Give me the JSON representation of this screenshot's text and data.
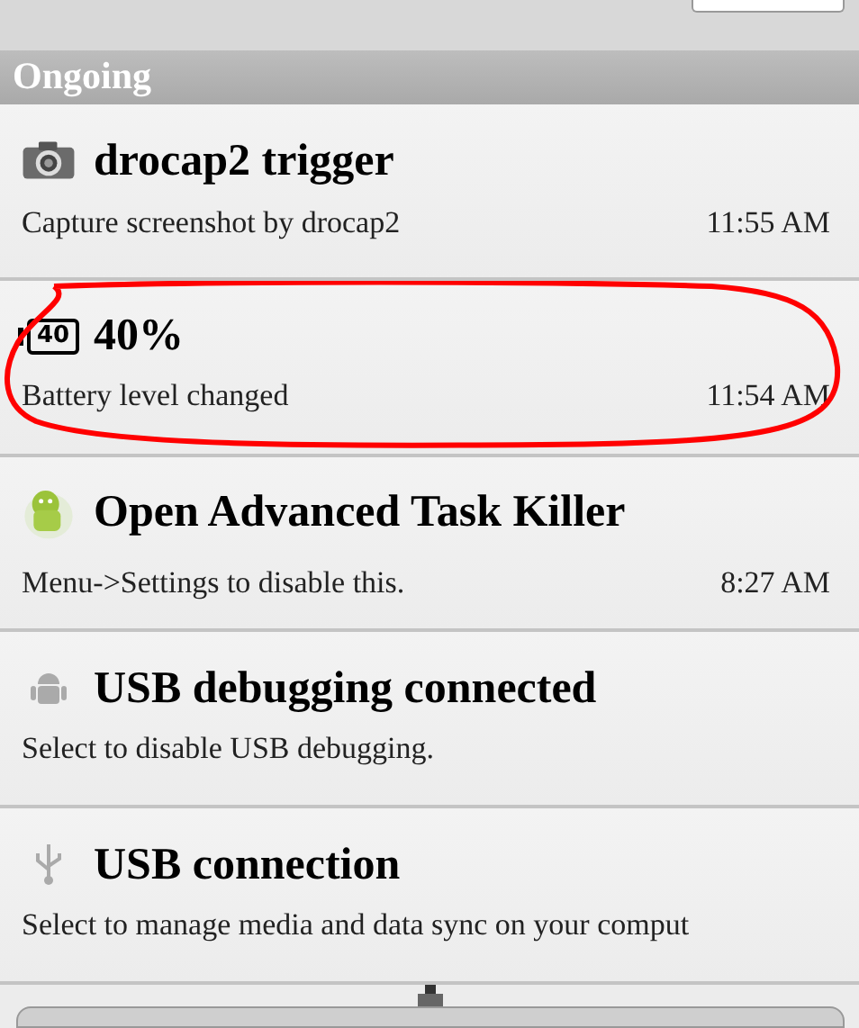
{
  "section": {
    "title": "Ongoing"
  },
  "notifications": [
    {
      "kind": "camera",
      "title": "drocap2 trigger",
      "subtitle": "Capture screenshot by drocap2",
      "time": "11:55 AM",
      "annotated": false
    },
    {
      "kind": "battery",
      "icon_text": "40",
      "title": "40%",
      "subtitle": "Battery level changed",
      "time": "11:54 AM",
      "annotated": true
    },
    {
      "kind": "robot-color",
      "title": "Open Advanced Task Killer",
      "subtitle": "Menu->Settings to disable this.",
      "time": "8:27 AM",
      "annotated": false
    },
    {
      "kind": "robot",
      "title": "USB debugging connected",
      "subtitle": "Select to disable USB debugging.",
      "annotated": false
    },
    {
      "kind": "usb",
      "title": "USB connection",
      "subtitle": "Select to manage media and data sync on your comput",
      "annotated": false
    }
  ]
}
